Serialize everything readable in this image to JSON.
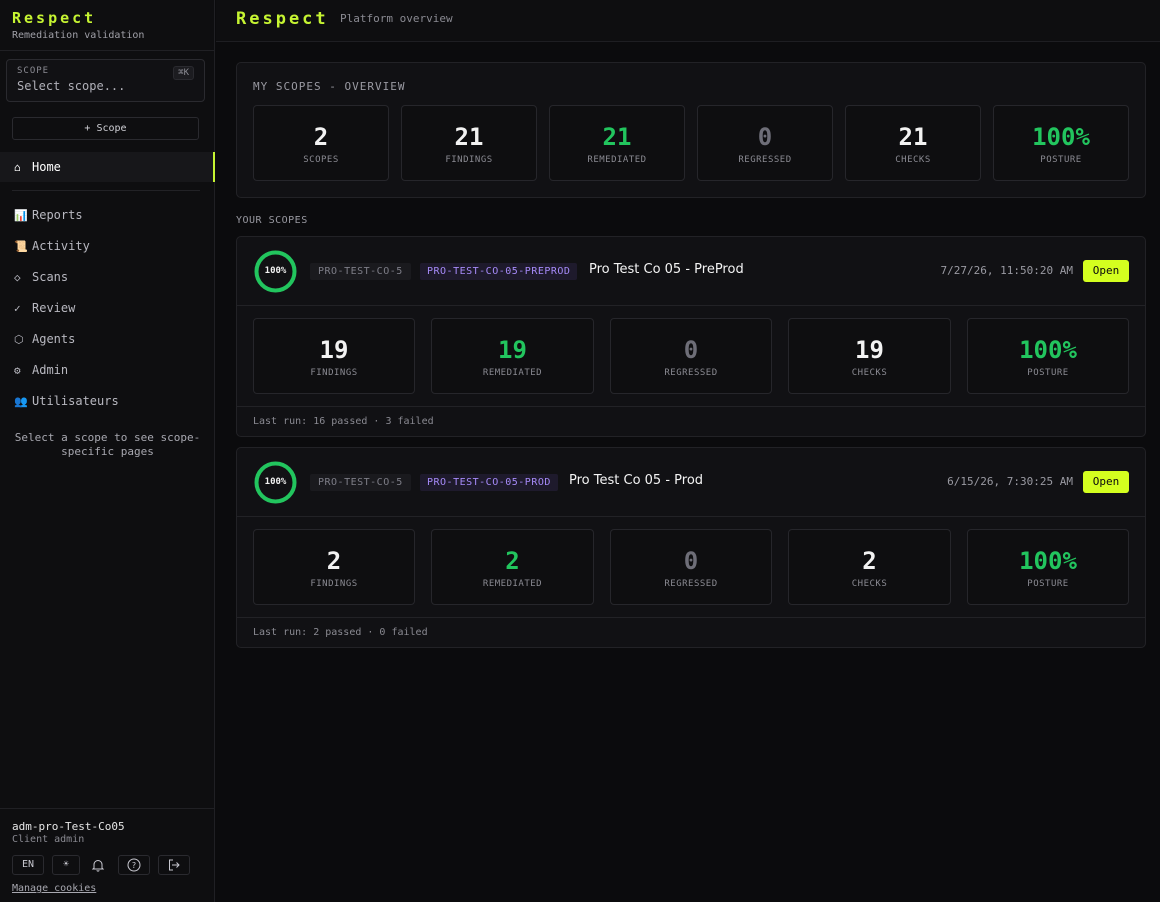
{
  "sidebar": {
    "brand_title": "Respect",
    "brand_subtitle": "Remediation validation",
    "scope_label": "SCOPE",
    "scope_shortcut": "⌘K",
    "scope_placeholder": "Select scope...",
    "add_scope_label": "+ Scope",
    "home_label": "Home",
    "home_icon": "⌂",
    "items": [
      {
        "icon": "📊",
        "label": "Reports"
      },
      {
        "icon": "📜",
        "label": "Activity"
      },
      {
        "icon": "◇",
        "label": "Scans"
      },
      {
        "icon": "✓",
        "label": "Review"
      },
      {
        "icon": "⬡",
        "label": "Agents"
      },
      {
        "icon": "⚙",
        "label": "Admin"
      },
      {
        "icon": "👥",
        "label": "Utilisateurs"
      }
    ],
    "hint": "Select a scope to see scope-specific pages",
    "user_name": "adm-pro-Test-Co05",
    "user_role": "Client admin",
    "lang_label": "EN",
    "theme_icon": "☀",
    "bell_icon": "🔔",
    "help_icon": "?",
    "logout_icon": "⇥",
    "manage_cookies": "Manage cookies"
  },
  "topbar": {
    "title": "Respect",
    "subtitle": "Platform overview"
  },
  "overview": {
    "title": "MY SCOPES - OVERVIEW",
    "stats": [
      {
        "value": "2",
        "label": "SCOPES"
      },
      {
        "value": "21",
        "label": "FINDINGS"
      },
      {
        "value": "21",
        "label": "REMEDIATED"
      },
      {
        "value": "0",
        "label": "REGRESSED"
      },
      {
        "value": "21",
        "label": "CHECKS"
      },
      {
        "value": "100%",
        "label": "POSTURE"
      }
    ]
  },
  "section_label": "YOUR SCOPES",
  "scopes": [
    {
      "posture_ring": "100%",
      "posture_fraction": 1.0,
      "org_code": "PRO-TEST-CO-5",
      "scope_code": "PRO-TEST-CO-05-PREPROD",
      "name": "Pro Test Co 05 - PreProd",
      "date": "7/27/26, 11:50:20 AM",
      "open_label": "Open",
      "stats": [
        {
          "value": "19",
          "label": "FINDINGS"
        },
        {
          "value": "19",
          "label": "REMEDIATED"
        },
        {
          "value": "0",
          "label": "REGRESSED"
        },
        {
          "value": "19",
          "label": "CHECKS"
        },
        {
          "value": "100%",
          "label": "POSTURE"
        }
      ],
      "last_run": "Last run: 16 passed · 3 failed"
    },
    {
      "posture_ring": "100%",
      "posture_fraction": 1.0,
      "org_code": "PRO-TEST-CO-5",
      "scope_code": "PRO-TEST-CO-05-PROD",
      "name": "Pro Test Co 05 - Prod",
      "date": "6/15/26, 7:30:25 AM",
      "open_label": "Open",
      "stats": [
        {
          "value": "2",
          "label": "FINDINGS"
        },
        {
          "value": "2",
          "label": "REMEDIATED"
        },
        {
          "value": "0",
          "label": "REGRESSED"
        },
        {
          "value": "2",
          "label": "CHECKS"
        },
        {
          "value": "100%",
          "label": "POSTURE"
        }
      ],
      "last_run": "Last run: 2 passed · 0 failed"
    }
  ],
  "colors": {
    "accent": "#c6f432",
    "green": "#22c55e",
    "purple": "#a78bfa",
    "open_button": "#d4ff1f"
  }
}
